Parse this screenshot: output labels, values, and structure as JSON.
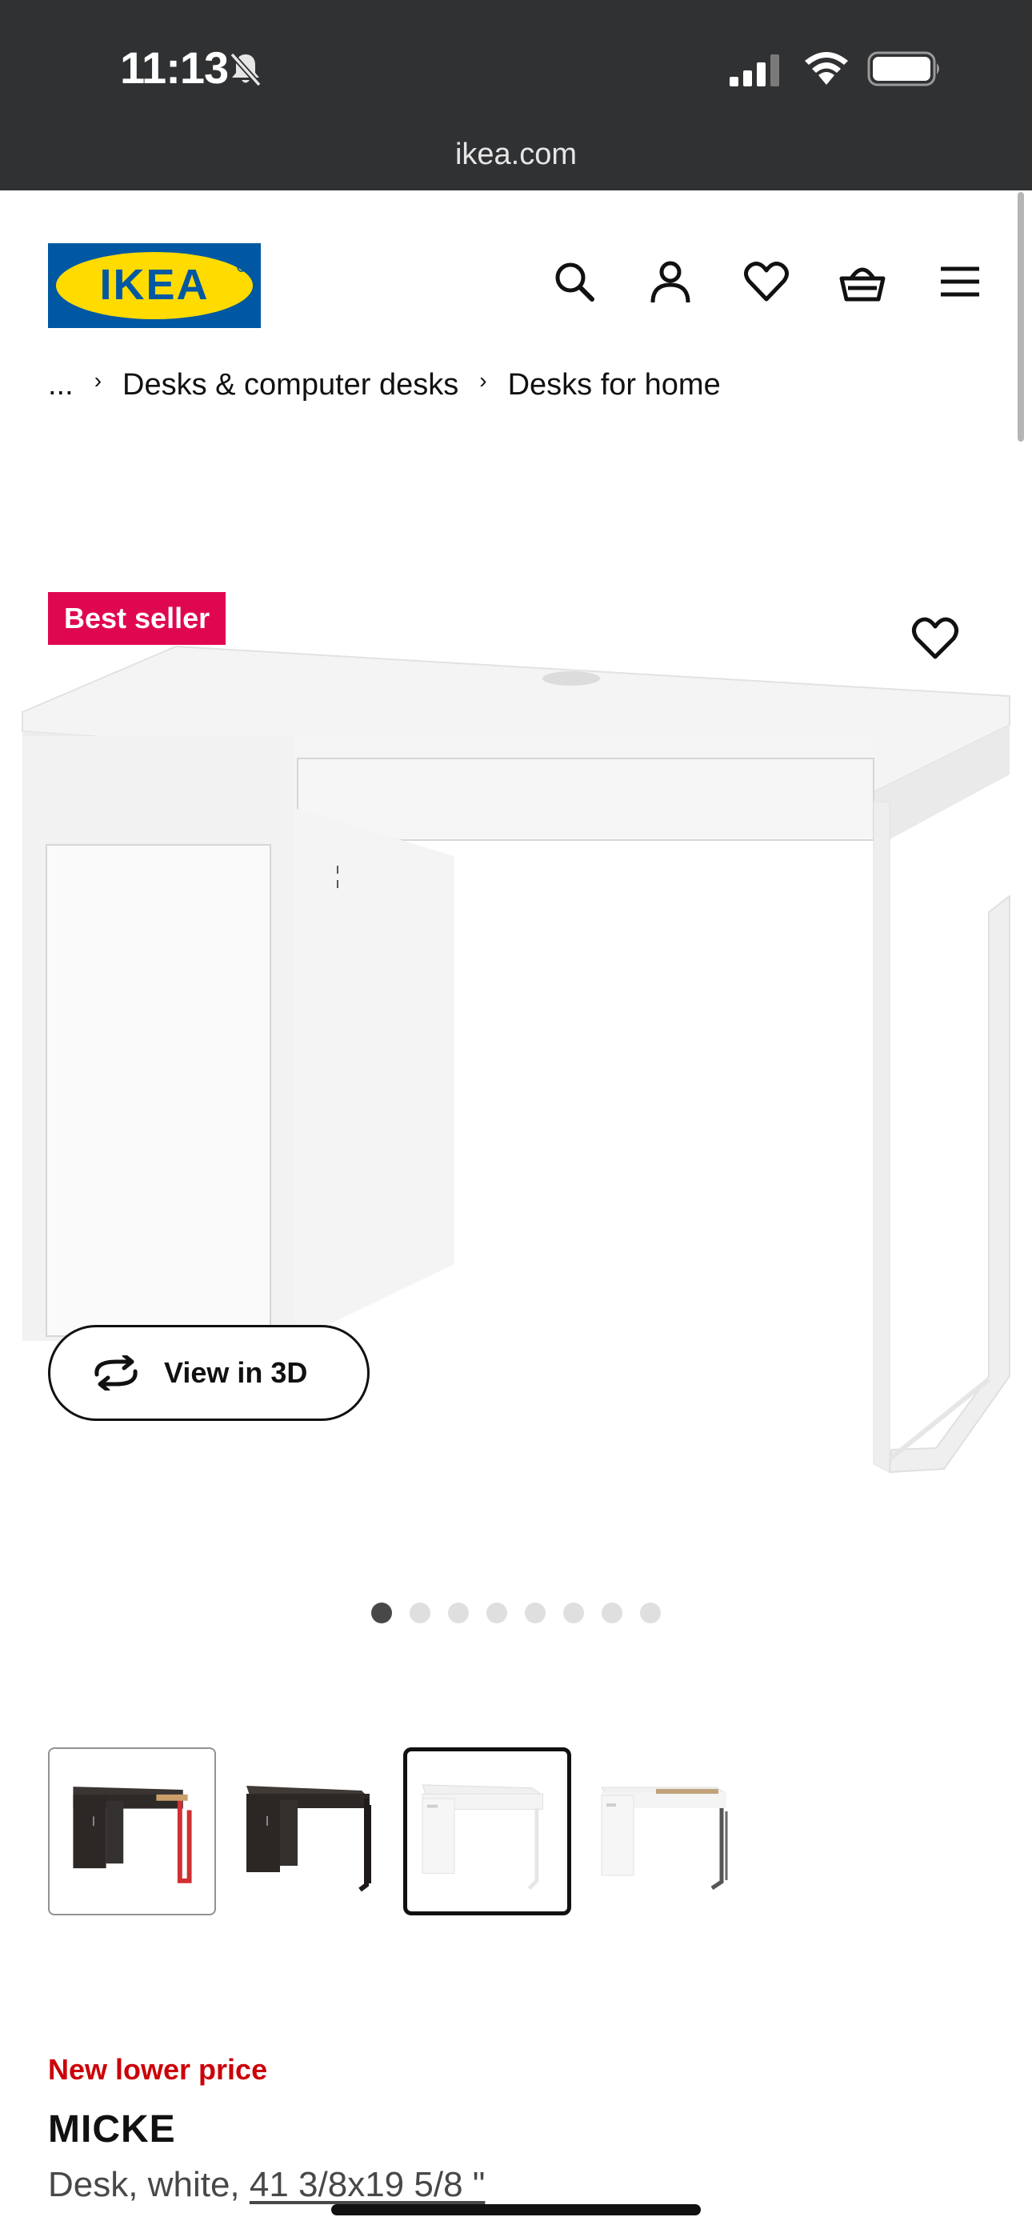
{
  "status_bar": {
    "time": "11:13",
    "icons": [
      "bell-slash-icon",
      "cellular-signal-icon",
      "wifi-icon",
      "battery-icon"
    ]
  },
  "browser": {
    "url": "ikea.com"
  },
  "header": {
    "logo_text": "IKEA",
    "icons": [
      "search-icon",
      "account-icon",
      "heart-icon",
      "basket-icon",
      "menu-icon"
    ],
    "brand_colors": {
      "blue": "#0058a3",
      "yellow": "#ffdb00"
    }
  },
  "breadcrumb": {
    "items": [
      "...",
      "Desks & computer desks",
      "Desks for home"
    ]
  },
  "product_image": {
    "badge": "Best seller",
    "badge_color": "#e00751",
    "view_3d_label": "View in 3D",
    "active_image_index": 1,
    "image_count": 8
  },
  "variants": [
    {
      "color": "black-brown/red",
      "selected": false
    },
    {
      "color": "black-brown",
      "selected": false
    },
    {
      "color": "white",
      "selected": true
    },
    {
      "color": "white/anthracite",
      "selected": false
    }
  ],
  "product": {
    "price_tag": "New lower price",
    "price_tag_color": "#cc0008",
    "name": "MICKE",
    "desc_prefix": "Desk, white, ",
    "dimensions": "41 3/8x19 5/8 \""
  }
}
